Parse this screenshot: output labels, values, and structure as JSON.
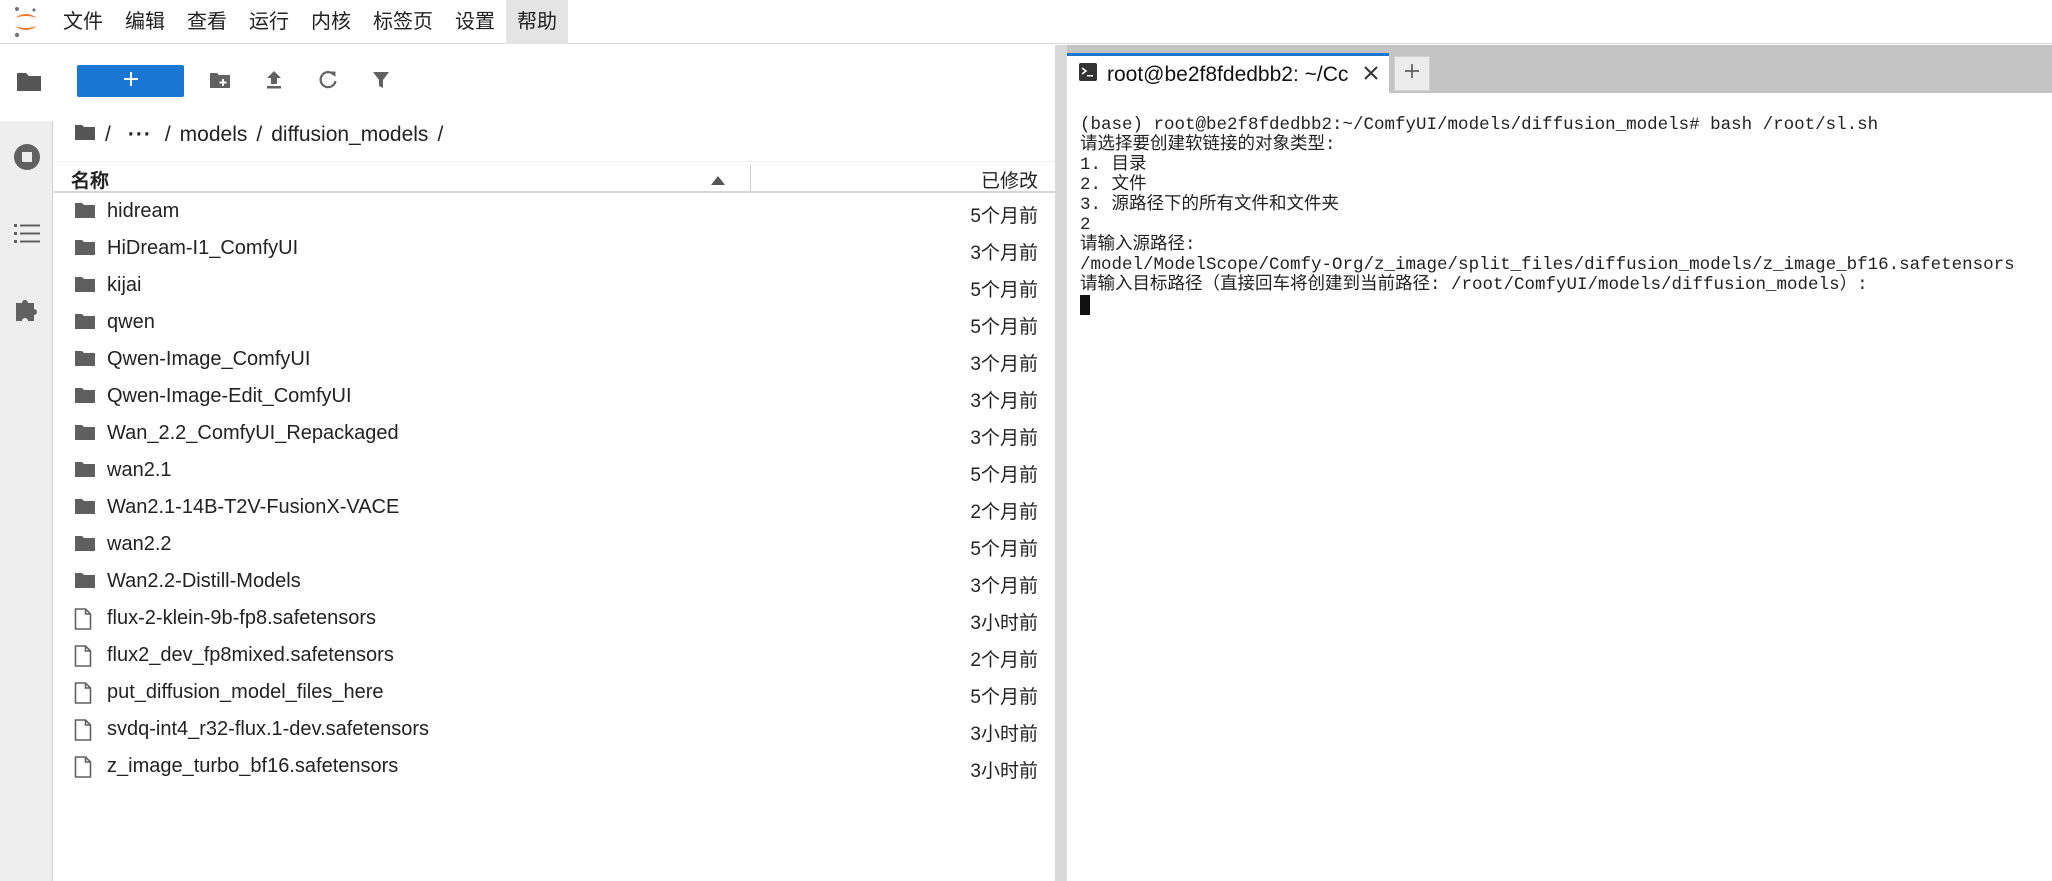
{
  "menubar": {
    "items": [
      {
        "label": "文件"
      },
      {
        "label": "编辑"
      },
      {
        "label": "查看"
      },
      {
        "label": "运行"
      },
      {
        "label": "内核"
      },
      {
        "label": "标签页"
      },
      {
        "label": "设置"
      },
      {
        "label": "帮助",
        "active": true
      }
    ]
  },
  "rail": {
    "items": [
      {
        "icon": "folder-icon",
        "active": true
      },
      {
        "icon": "running-kernels-icon"
      },
      {
        "icon": "table-of-contents-icon"
      },
      {
        "icon": "extension-puzzle-icon"
      }
    ]
  },
  "filebrowser": {
    "toolbar": {
      "new_label": "+",
      "icons": [
        "new-folder-icon",
        "upload-icon",
        "refresh-icon",
        "filter-icon"
      ]
    },
    "breadcrumb": {
      "root": "/",
      "ellipsis": "···",
      "segments": [
        "models",
        "diffusion_models"
      ],
      "separator": "/"
    },
    "columns": {
      "name": "名称",
      "modified": "已修改"
    },
    "files": [
      {
        "name": "hidream",
        "type": "folder",
        "modified": "5个月前"
      },
      {
        "name": "HiDream-I1_ComfyUI",
        "type": "folder",
        "modified": "3个月前"
      },
      {
        "name": "kijai",
        "type": "folder",
        "modified": "5个月前"
      },
      {
        "name": "qwen",
        "type": "folder",
        "modified": "5个月前"
      },
      {
        "name": "Qwen-Image_ComfyUI",
        "type": "folder",
        "modified": "3个月前"
      },
      {
        "name": "Qwen-Image-Edit_ComfyUI",
        "type": "folder",
        "modified": "3个月前"
      },
      {
        "name": "Wan_2.2_ComfyUI_Repackaged",
        "type": "folder",
        "modified": "3个月前"
      },
      {
        "name": "wan2.1",
        "type": "folder",
        "modified": "5个月前"
      },
      {
        "name": "Wan2.1-14B-T2V-FusionX-VACE",
        "type": "folder",
        "modified": "2个月前"
      },
      {
        "name": "wan2.2",
        "type": "folder",
        "modified": "5个月前"
      },
      {
        "name": "Wan2.2-Distill-Models",
        "type": "folder",
        "modified": "3个月前"
      },
      {
        "name": "flux-2-klein-9b-fp8.safetensors",
        "type": "file",
        "modified": "3小时前"
      },
      {
        "name": "flux2_dev_fp8mixed.safetensors",
        "type": "file",
        "modified": "2个月前"
      },
      {
        "name": "put_diffusion_model_files_here",
        "type": "file",
        "modified": "5个月前"
      },
      {
        "name": "svdq-int4_r32-flux.1-dev.safetensors",
        "type": "file",
        "modified": "3小时前"
      },
      {
        "name": "z_image_turbo_bf16.safetensors",
        "type": "file",
        "modified": "3小时前"
      }
    ]
  },
  "terminal": {
    "tab_label": "root@be2f8fdedbb2: ~/Cc",
    "add_tab_label": "+",
    "lines": [
      "(base) root@be2f8fdedbb2:~/ComfyUI/models/diffusion_models# bash /root/sl.sh",
      "请选择要创建软链接的对象类型:",
      "1. 目录",
      "2. 文件",
      "3. 源路径下的所有文件和文件夹",
      "2",
      "请输入源路径:",
      "/model/ModelScope/Comfy-Org/z_image/split_files/diffusion_models/z_image_bf16.safetensors",
      "请输入目标路径（直接回车将创建到当前路径: /root/ComfyUI/models/diffusion_models）:"
    ]
  },
  "colors": {
    "accent": "#1976d2",
    "logo_orange": "#f37726",
    "rail_bg": "#eeeeee",
    "tabbar_bg": "#c4c4c4"
  }
}
